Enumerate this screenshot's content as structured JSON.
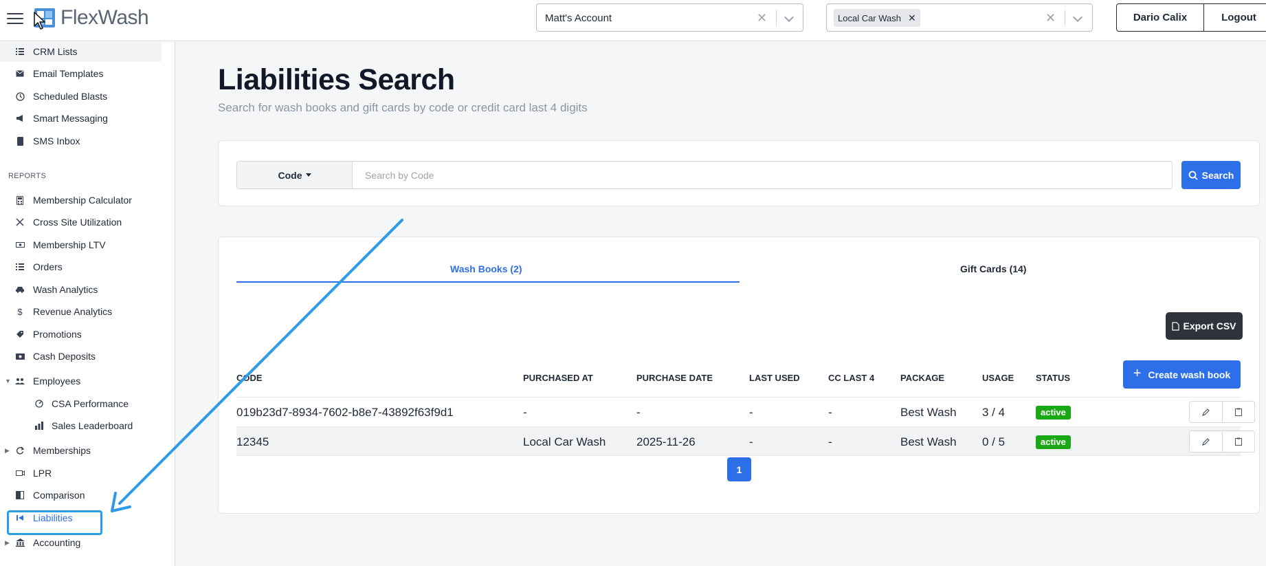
{
  "header": {
    "brand": "FlexWash",
    "account_select": {
      "value": "Matt's Account"
    },
    "site_select": {
      "chip": "Local Car Wash"
    },
    "user_button": "Dario Calix",
    "logout_button": "Logout"
  },
  "sidebar": {
    "items_top": [
      {
        "label": "CRM Lists",
        "icon": "list-icon"
      },
      {
        "label": "Email Templates",
        "icon": "envelope-icon"
      },
      {
        "label": "Scheduled Blasts",
        "icon": "clock-icon"
      },
      {
        "label": "Smart Messaging",
        "icon": "megaphone-icon"
      },
      {
        "label": "SMS Inbox",
        "icon": "phone-icon"
      }
    ],
    "reports_label": "REPORTS",
    "reports": [
      {
        "label": "Membership Calculator",
        "icon": "calculator-icon"
      },
      {
        "label": "Cross Site Utilization",
        "icon": "shuffle-icon"
      },
      {
        "label": "Membership LTV",
        "icon": "money-icon"
      },
      {
        "label": "Orders",
        "icon": "list-icon"
      },
      {
        "label": "Wash Analytics",
        "icon": "car-icon"
      },
      {
        "label": "Revenue Analytics",
        "icon": "dollar-icon"
      },
      {
        "label": "Promotions",
        "icon": "tag-icon"
      },
      {
        "label": "Cash Deposits",
        "icon": "cash-icon"
      },
      {
        "label": "Employees",
        "icon": "users-icon"
      },
      {
        "label": "CSA Performance",
        "icon": "gauge-icon"
      },
      {
        "label": "Sales Leaderboard",
        "icon": "bar-chart-icon"
      },
      {
        "label": "Memberships",
        "icon": "refresh-icon"
      },
      {
        "label": "LPR",
        "icon": "camera-icon"
      },
      {
        "label": "Comparison",
        "icon": "compare-icon"
      },
      {
        "label": "Liabilities",
        "icon": "rewind-icon"
      },
      {
        "label": "Accounting",
        "icon": "bank-icon"
      }
    ]
  },
  "main": {
    "title": "Liabilities Search",
    "subtitle": "Search for wash books and gift cards by code or credit card last 4 digits",
    "search": {
      "mode_label": "Code",
      "placeholder": "Search by Code",
      "value": "",
      "button": "Search"
    },
    "tabs": [
      {
        "label": "Wash Books (2)",
        "active": true
      },
      {
        "label": "Gift Cards (14)",
        "active": false
      }
    ],
    "export_button": "Export CSV",
    "create_button": "Create wash book",
    "table": {
      "headers": [
        "CODE",
        "PURCHASED AT",
        "PURCHASE DATE",
        "LAST USED",
        "CC LAST 4",
        "PACKAGE",
        "USAGE",
        "STATUS"
      ],
      "rows": [
        {
          "code": "019b23d7-8934-7602-b8e7-43892f63f9d1",
          "purchased_at": "-",
          "purchase_date": "-",
          "last_used": "-",
          "cc_last4": "-",
          "package": "Best Wash",
          "usage": "3 / 4",
          "status": "active"
        },
        {
          "code": "12345",
          "purchased_at": "Local Car Wash",
          "purchase_date": "2025-11-26",
          "last_used": "-",
          "cc_last4": "-",
          "package": "Best Wash",
          "usage": "0 / 5",
          "status": "active"
        }
      ]
    },
    "pagination": {
      "current": "1"
    }
  },
  "colors": {
    "accent": "#2d6fe8",
    "status_active": "#1aa815",
    "annotation": "#2d9be8"
  }
}
